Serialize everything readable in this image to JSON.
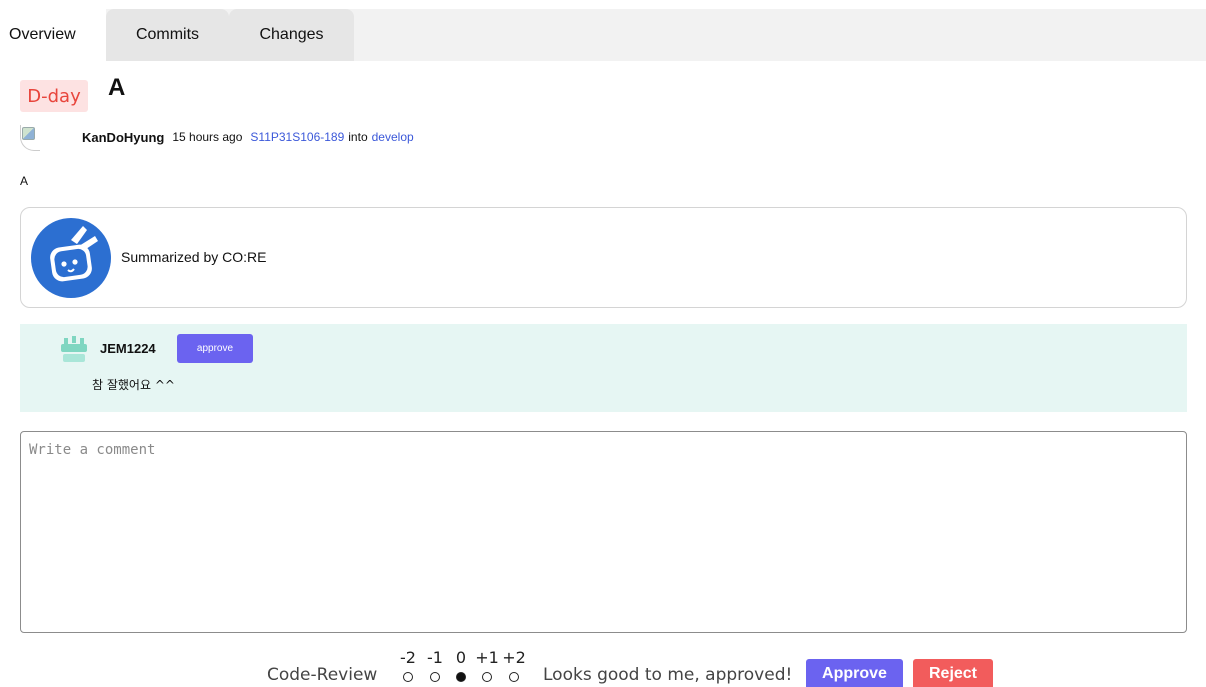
{
  "tabs": [
    {
      "label": "Overview",
      "active": true
    },
    {
      "label": "Commits",
      "active": false
    },
    {
      "label": "Changes",
      "active": false
    }
  ],
  "header": {
    "badge": "D-day",
    "title": "A"
  },
  "meta": {
    "author": "KanDoHyung",
    "time": "15 hours ago",
    "source_branch": "S11P31S106-189",
    "into": "into",
    "target_branch": "develop"
  },
  "description": "A",
  "summary": {
    "text": "Summarized by CO:RE",
    "logo_color": "#2c6fd1"
  },
  "review": {
    "user": "JEM1224",
    "badge": "approve",
    "comment": "참 잘했어요 ^^"
  },
  "comment_box": {
    "placeholder": "Write a comment",
    "value": ""
  },
  "code_review": {
    "label": "Code-Review",
    "scale": [
      "-2",
      "-1",
      "0",
      "+1",
      "+2"
    ],
    "selected": "0",
    "message": "Looks good to me, approved!"
  },
  "actions": {
    "approve": "Approve",
    "reject": "Reject"
  },
  "colors": {
    "accent": "#6b63f0",
    "danger": "#f25c5c",
    "review_bg": "#e6f6f3",
    "dday_bg": "#fde2e2",
    "dday_text": "#e8453c"
  }
}
